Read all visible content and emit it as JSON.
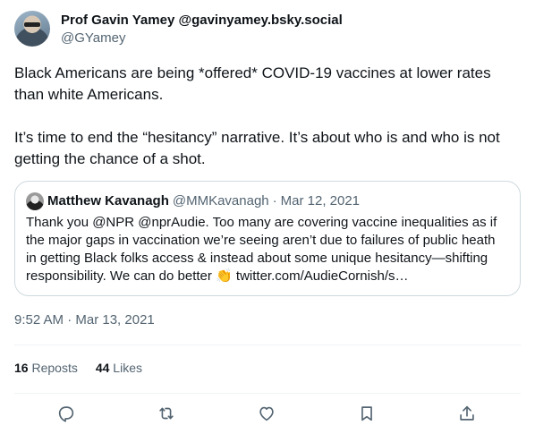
{
  "author": {
    "display_name": "Prof Gavin Yamey @gavinyamey.bsky.social",
    "handle": "@GYamey"
  },
  "tweet": {
    "paragraph1": "Black Americans are being *offered* COVID-19 vaccines at lower rates than white Americans.",
    "paragraph2": "It’s time to end the “hesitancy” narrative. It’s about who is and who is not getting the chance of a shot."
  },
  "quote": {
    "name": "Matthew Kavanagh",
    "handle": "@MMKavanagh",
    "separator": "·",
    "date": "Mar 12, 2021",
    "text": "Thank you @NPR @nprAudie. Too many are covering vaccine inequalities as if the major gaps in vaccination we’re seeing aren’t due to failures of public heath in getting Black folks access & instead about some unique hesitancy—shifting responsibility. We can do better",
    "emoji": "👏",
    "link": "twitter.com/AudieCornish/s…"
  },
  "timestamp": "9:52 AM · Mar 13, 2021",
  "stats": {
    "reposts_count": "16",
    "reposts_label": "Reposts",
    "likes_count": "44",
    "likes_label": "Likes"
  },
  "actions": {
    "icons": [
      "reply-icon",
      "repost-icon",
      "like-icon",
      "bookmark-icon",
      "share-icon"
    ]
  },
  "colors": {
    "text_primary": "#0f1419",
    "text_secondary": "#536471",
    "border": "#cfd9de"
  }
}
